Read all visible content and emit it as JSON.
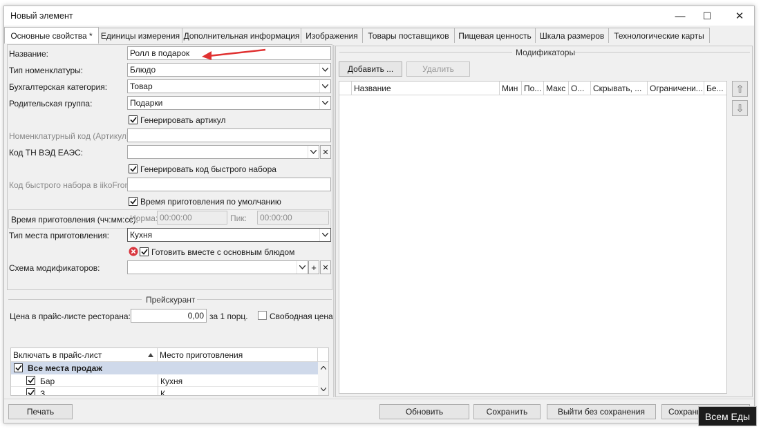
{
  "window": {
    "title": "Новый элемент",
    "minimize_glyph": "—",
    "maximize_glyph": "☐",
    "close_glyph": "✕"
  },
  "tabs": [
    {
      "label": "Основные свойства *"
    },
    {
      "label": "Единицы измерения"
    },
    {
      "label": "Дополнительная информация"
    },
    {
      "label": "Изображения"
    },
    {
      "label": "Товары поставщиков"
    },
    {
      "label": "Пищевая ценность"
    },
    {
      "label": "Шкала размеров"
    },
    {
      "label": "Технологические карты"
    }
  ],
  "form": {
    "name_label": "Название:",
    "name_value": "Ролл в подарок",
    "type_label": "Тип номенклатуры:",
    "type_value": "Блюдо",
    "accounting_label": "Бухгалтерская категория:",
    "accounting_value": "Товар",
    "parent_label": "Родительская группа:",
    "parent_value": "Подарки",
    "gen_article_label": "Генерировать артикул",
    "article_label": "Номенклатурный код (Артикул):",
    "article_value": "",
    "tnved_label": "Код ТН ВЭД ЕАЭС:",
    "tnved_value": "",
    "gen_quick_label": "Генерировать код быстрого набора",
    "quick_code_label": "Код быстрого набора в iikoFront:",
    "quick_code_value": "",
    "default_time_label": "Время приготовления по умолчанию",
    "cook_time_label": "Время приготовления (чч:мм:сс):",
    "norm_label": "Норма:",
    "norm_value": "00:00:00",
    "peak_label": "Пик:",
    "peak_value": "00:00:00",
    "place_label": "Тип места приготовления:",
    "place_value": "Кухня",
    "cook_together_label": "Готовить вместе с основным блюдом",
    "modifier_scheme_label": "Схема модификаторов:",
    "modifier_scheme_value": ""
  },
  "price": {
    "group_title": "Прейскурант",
    "price_label": "Цена в прайс-листе ресторана:",
    "price_value": "0,00",
    "per_portion": "за 1 порц.",
    "free_price_label": "Свободная цена",
    "table_headers": [
      "Включать в прайс-лист",
      "Место приготовления"
    ],
    "rows": [
      {
        "label": "Все места продаж",
        "place": "",
        "checked": true
      },
      {
        "label": "Бар",
        "place": "Кухня",
        "checked": true
      },
      {
        "label": "З",
        "place": "К",
        "checked": true
      }
    ]
  },
  "modifiers": {
    "group_title": "Модификаторы",
    "add_label": "Добавить ...",
    "delete_label": "Удалить",
    "columns": [
      "Название",
      "Мин",
      "По...",
      "Макс",
      "О...",
      "Скрывать, ...",
      "Ограничени...",
      "Бе..."
    ],
    "up_glyph": "⇧",
    "down_glyph": "⇩"
  },
  "footer": {
    "print_label": "Печать",
    "refresh_label": "Обновить",
    "save_label": "Сохранить",
    "exit_label": "Выйти без сохранения",
    "save_close_label": "Сохрани"
  },
  "watermark": "Всем Еды",
  "colors": {
    "arrow": "#e03131",
    "error_icon": "#d9363e",
    "row_group_bg": "#cfd9ea"
  }
}
